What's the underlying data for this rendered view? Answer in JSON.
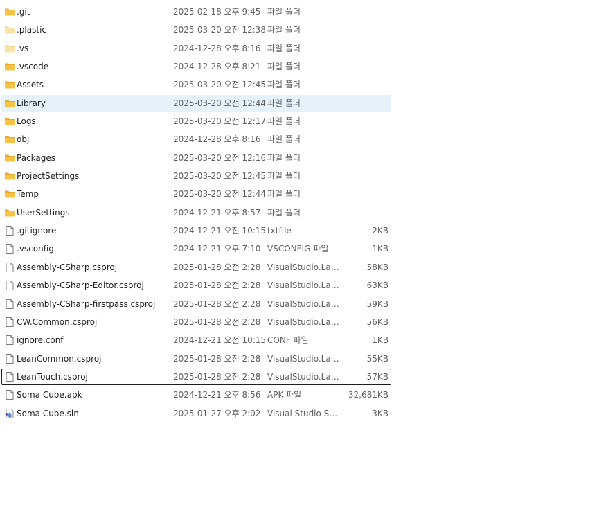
{
  "colors": {
    "folder_back": "#e8a92a",
    "folder_front": "#f5c444",
    "selected_bg": "#e5f1fb",
    "secondary_text": "#606060"
  },
  "files": [
    {
      "name": ".git",
      "date": "2025-02-18 오후 9:45",
      "type": "파일 폴더",
      "size": "",
      "icon": "folder-icon",
      "state": ""
    },
    {
      "name": ".plastic",
      "date": "2025-03-20 오전 12:38",
      "type": "파일 폴더",
      "size": "",
      "icon": "folder-light-icon",
      "state": ""
    },
    {
      "name": ".vs",
      "date": "2024-12-28 오후 8:16",
      "type": "파일 폴더",
      "size": "",
      "icon": "folder-light-icon",
      "state": ""
    },
    {
      "name": ".vscode",
      "date": "2024-12-28 오후 8:21",
      "type": "파일 폴더",
      "size": "",
      "icon": "folder-icon",
      "state": ""
    },
    {
      "name": "Assets",
      "date": "2025-03-20 오전 12:45",
      "type": "파일 폴더",
      "size": "",
      "icon": "folder-icon",
      "state": ""
    },
    {
      "name": "Library",
      "date": "2025-03-20 오전 12:44",
      "type": "파일 폴더",
      "size": "",
      "icon": "folder-icon",
      "state": "selected"
    },
    {
      "name": "Logs",
      "date": "2025-03-20 오전 12:17",
      "type": "파일 폴더",
      "size": "",
      "icon": "folder-icon",
      "state": ""
    },
    {
      "name": "obj",
      "date": "2024-12-28 오후 8:16",
      "type": "파일 폴더",
      "size": "",
      "icon": "folder-icon",
      "state": ""
    },
    {
      "name": "Packages",
      "date": "2025-03-20 오전 12:16",
      "type": "파일 폴더",
      "size": "",
      "icon": "folder-icon",
      "state": ""
    },
    {
      "name": "ProjectSettings",
      "date": "2025-03-20 오전 12:45",
      "type": "파일 폴더",
      "size": "",
      "icon": "folder-icon",
      "state": ""
    },
    {
      "name": "Temp",
      "date": "2025-03-20 오전 12:44",
      "type": "파일 폴더",
      "size": "",
      "icon": "folder-icon",
      "state": ""
    },
    {
      "name": "UserSettings",
      "date": "2024-12-21 오후 8:57",
      "type": "파일 폴더",
      "size": "",
      "icon": "folder-icon",
      "state": ""
    },
    {
      "name": ".gitignore",
      "date": "2024-12-21 오전 10:15",
      "type": "txtfile",
      "size": "2KB",
      "icon": "file-icon",
      "state": ""
    },
    {
      "name": ".vsconfig",
      "date": "2024-12-21 오후 7:10",
      "type": "VSCONFIG 파일",
      "size": "1KB",
      "icon": "file-icon",
      "state": ""
    },
    {
      "name": "Assembly-CSharp.csproj",
      "date": "2025-01-28 오전 2:28",
      "type": "VisualStudio.Laun...",
      "size": "58KB",
      "icon": "file-icon",
      "state": ""
    },
    {
      "name": "Assembly-CSharp-Editor.csproj",
      "date": "2025-01-28 오전 2:28",
      "type": "VisualStudio.Laun...",
      "size": "63KB",
      "icon": "file-icon",
      "state": ""
    },
    {
      "name": "Assembly-CSharp-firstpass.csproj",
      "date": "2025-01-28 오전 2:28",
      "type": "VisualStudio.Laun...",
      "size": "59KB",
      "icon": "file-icon",
      "state": ""
    },
    {
      "name": "CW.Common.csproj",
      "date": "2025-01-28 오전 2:28",
      "type": "VisualStudio.Laun...",
      "size": "56KB",
      "icon": "file-icon",
      "state": ""
    },
    {
      "name": "ignore.conf",
      "date": "2024-12-21 오전 10:15",
      "type": "CONF 파일",
      "size": "1KB",
      "icon": "file-icon",
      "state": ""
    },
    {
      "name": "LeanCommon.csproj",
      "date": "2025-01-28 오전 2:28",
      "type": "VisualStudio.Laun...",
      "size": "55KB",
      "icon": "file-icon",
      "state": ""
    },
    {
      "name": "LeanTouch.csproj",
      "date": "2025-01-28 오전 2:28",
      "type": "VisualStudio.Laun...",
      "size": "57KB",
      "icon": "file-icon",
      "state": "focused"
    },
    {
      "name": "Soma Cube.apk",
      "date": "2024-12-21 오후 8:56",
      "type": "APK 파일",
      "size": "32,681KB",
      "icon": "file-icon",
      "state": ""
    },
    {
      "name": "Soma Cube.sln",
      "date": "2025-01-27 오후 2:02",
      "type": "Visual Studio Sol...",
      "size": "3KB",
      "icon": "visual-studio-solution-icon",
      "state": ""
    }
  ]
}
